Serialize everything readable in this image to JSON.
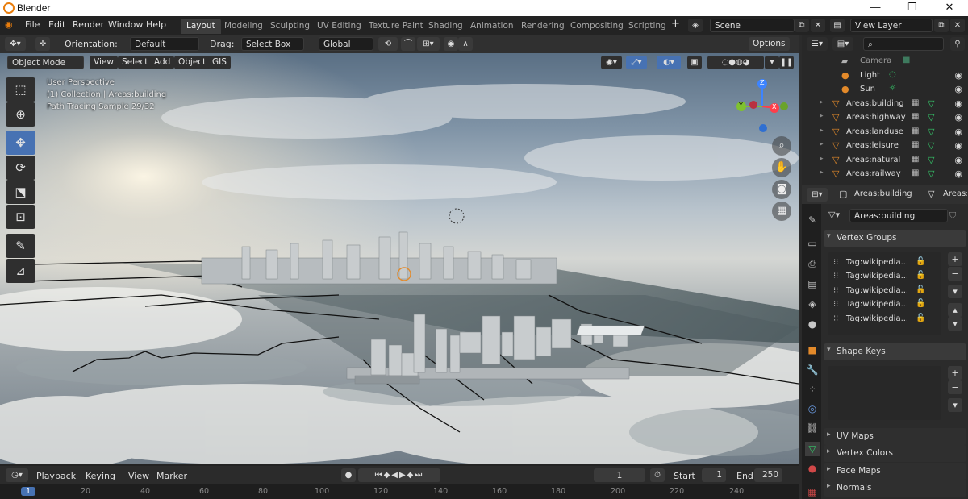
{
  "window": {
    "title": "Blender",
    "min": "—",
    "max": "❐",
    "close": "✕"
  },
  "menu": [
    "File",
    "Edit",
    "Render",
    "Window",
    "Help"
  ],
  "workspaces": [
    "Layout",
    "Modeling",
    "Sculpting",
    "UV Editing",
    "Texture Paint",
    "Shading",
    "Animation",
    "Rendering",
    "Compositing",
    "Scripting"
  ],
  "workspace_add": "+",
  "scene": "Scene",
  "view_layer": "View Layer",
  "tool_header": {
    "orientation_label": "Orientation:",
    "orientation": "Default",
    "drag_label": "Drag:",
    "drag": "Select Box",
    "transform": "Global",
    "options": "Options"
  },
  "viewport_header": {
    "mode": "Object Mode",
    "view": "View",
    "select": "Select",
    "add": "Add",
    "object": "Object",
    "gis": "GIS"
  },
  "overlay_text": {
    "line1": "User Perspective",
    "line2": "(1) Collection | Areas:building",
    "line3": "Path Tracing Sample 29/32"
  },
  "gizmo": {
    "z": "Z",
    "y": "Y",
    "x": "X"
  },
  "outliner": {
    "rows": [
      {
        "name": "Camera",
        "type": "camera"
      },
      {
        "name": "Light",
        "type": "light"
      },
      {
        "name": "Sun",
        "type": "light"
      },
      {
        "name": "Areas:building",
        "type": "mesh"
      },
      {
        "name": "Areas:highway",
        "type": "mesh"
      },
      {
        "name": "Areas:landuse",
        "type": "mesh"
      },
      {
        "name": "Areas:leisure",
        "type": "mesh"
      },
      {
        "name": "Areas:natural",
        "type": "mesh"
      },
      {
        "name": "Areas:railway",
        "type": "mesh"
      }
    ]
  },
  "properties": {
    "breadcrumb_object": "Areas:building",
    "breadcrumb_data": "Areas:b",
    "data_name": "Areas:building",
    "vertex_groups_title": "Vertex Groups",
    "vertex_groups": [
      "Tag:wikipedia...",
      "Tag:wikipedia...",
      "Tag:wikipedia...",
      "Tag:wikipedia...",
      "Tag:wikipedia..."
    ],
    "shape_keys_title": "Shape Keys",
    "collapsed_panels": [
      "UV Maps",
      "Vertex Colors",
      "Face Maps",
      "Normals"
    ]
  },
  "timeline": {
    "playback": "Playback",
    "keying": "Keying",
    "view": "View",
    "marker": "Marker",
    "current_frame": "1",
    "start_label": "Start",
    "start": "1",
    "end_label": "End",
    "end": "250",
    "ticks": [
      "1",
      "20",
      "40",
      "60",
      "80",
      "100",
      "120",
      "140",
      "160",
      "180",
      "200",
      "220",
      "240"
    ]
  },
  "colors": {
    "accent": "#4772b3",
    "object_orange": "#e38a2a",
    "mesh_green": "#35c96a"
  },
  "icons": {
    "blender": "blender-logo-icon",
    "select": "select-box-icon",
    "cursor": "cursor-icon",
    "move": "move-icon",
    "rotate": "rotate-icon",
    "scale": "scale-icon",
    "transform": "transform-icon",
    "annotate": "annotate-icon",
    "measure": "measure-icon"
  }
}
